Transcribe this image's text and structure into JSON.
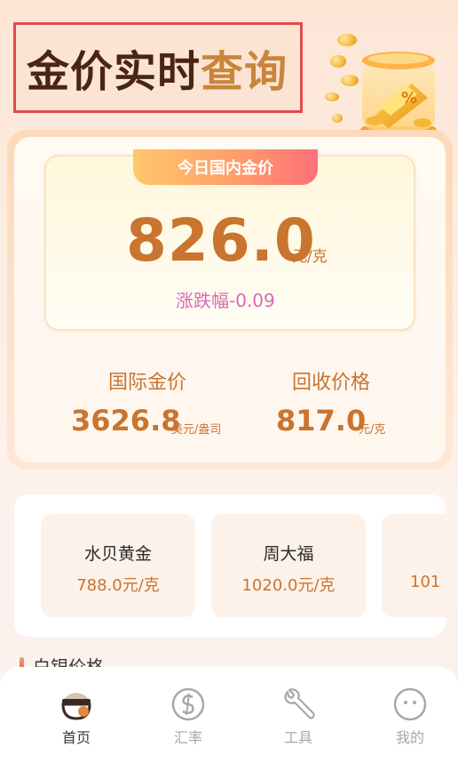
{
  "header": {
    "title_part1": "金价实时",
    "title_part2": "查询"
  },
  "domestic": {
    "badge": "今日国内金价",
    "price": "826.0",
    "unit": "元/克",
    "change": "涨跌幅-0.09"
  },
  "international": {
    "label": "国际金价",
    "price": "3626.8",
    "unit": "美元/盎司"
  },
  "recycle": {
    "label": "回收价格",
    "price": "817.0",
    "unit": "元/克"
  },
  "brands": [
    {
      "name": "水贝黄金",
      "price": "788.0元/克"
    },
    {
      "name": "周大福",
      "price": "1020.0元/克"
    },
    {
      "name": "",
      "price": "101"
    }
  ],
  "silver": {
    "title": "白银价格"
  },
  "nav": [
    {
      "label": "首页",
      "icon": "home-bowl-icon",
      "active": true
    },
    {
      "label": "汇率",
      "icon": "exchange-rate-icon",
      "active": false
    },
    {
      "label": "工具",
      "icon": "wrench-icon",
      "active": false
    },
    {
      "label": "我的",
      "icon": "profile-face-icon",
      "active": false
    }
  ],
  "colors": {
    "accent": "#c9742f",
    "title_dark": "#4a2414",
    "title_gold": "#c9853a",
    "change_pink": "#d86bb3",
    "border_red": "#e5484d"
  }
}
